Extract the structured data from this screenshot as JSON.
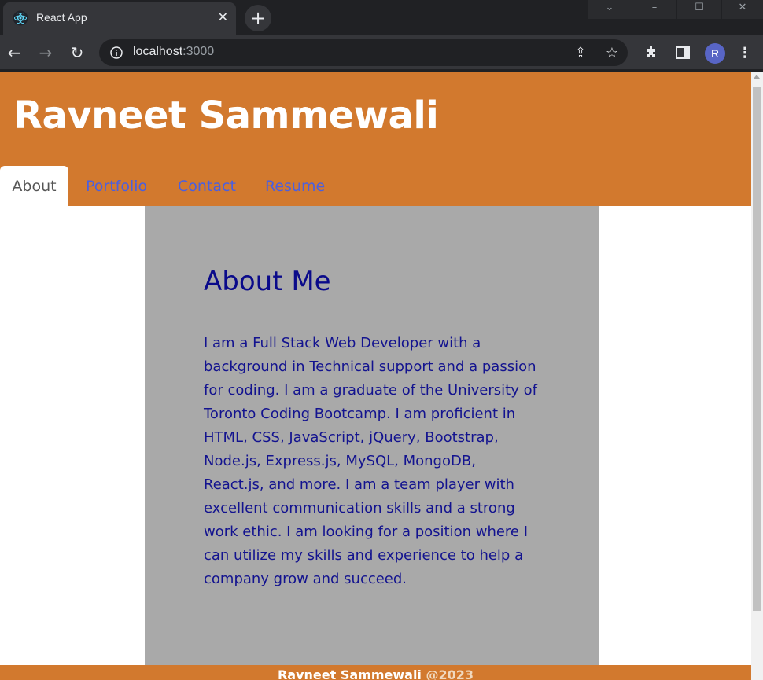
{
  "browser": {
    "tab_title": "React App",
    "tab_close_glyph": "✕",
    "new_tab_glyph": "+",
    "url_host": "localhost",
    "url_port": ":3000",
    "profile_initial": "R",
    "icons": [
      "react-favicon",
      "back-arrow-icon",
      "forward-arrow-icon",
      "reload-icon",
      "info-icon",
      "share-icon",
      "star-icon",
      "extensions-icon",
      "side-panel-icon",
      "kebab-menu-icon"
    ]
  },
  "site": {
    "title": "Ravneet Sammewali",
    "nav": [
      {
        "label": "About",
        "active": true
      },
      {
        "label": "Portfolio",
        "active": false
      },
      {
        "label": "Contact",
        "active": false
      },
      {
        "label": "Resume",
        "active": false
      }
    ],
    "about": {
      "heading": "About Me",
      "body": "I am a Full Stack Web Developer with a background in Technical support and a passion for coding. I am a graduate of the University of Toronto Coding Bootcamp. I am proficient in HTML, CSS, JavaScript, jQuery, Bootstrap, Node.js, Express.js, MySQL, MongoDB, React.js, and more. I am a team player with excellent communication skills and a strong work ethic. I am looking for a position where I can utilize my skills and experience to help a company grow and succeed."
    },
    "footer": {
      "name": "Ravneet Sammewali",
      "year": "@2023"
    }
  },
  "colors": {
    "header_bg": "#d2792e",
    "card_bg": "#a9a9a9",
    "heading_text": "#0a0a8a",
    "nav_link": "#4a5fe0"
  }
}
